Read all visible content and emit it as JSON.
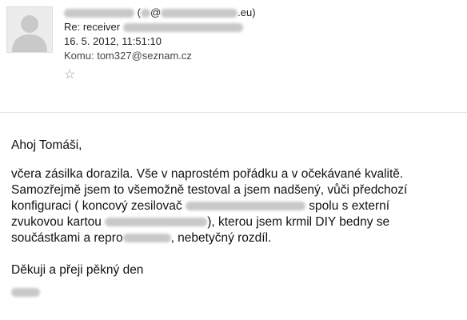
{
  "header": {
    "sender_paren_open": "(",
    "sender_at": "@",
    "sender_domain_tail": ".eu)",
    "subject": "Re: receiver",
    "date": "16. 5. 2012, 11:51:10",
    "to_label": "Komu:",
    "to_email": "tom327@seznam.cz",
    "star": "☆"
  },
  "body": {
    "greeting": "Ahoj Tomáši,",
    "para1_line1": "včera zásilka dorazila. Vše v naprostém pořádku a v očekávané kvalitě.",
    "para1_line2": "Samozřejmě jsem to všemožně testoval a jsem nadšený, vůči předchozí",
    "para1_line3_a": "konfiguraci ( koncový zesilovač",
    "para1_line3_b": "spolu s externí",
    "para1_line4_a": "zvukovou kartou",
    "para1_line4_b": "), kterou jsem krmil DIY bedny se",
    "para1_line5_a": "součástkami a repro",
    "para1_line5_b": ", nebetyčný rozdíl.",
    "closing": "Děkuji a přeji pěkný den"
  },
  "colors": {
    "divider": "#e2e2e2",
    "redaction": "#c8c8c8",
    "star": "#999999"
  },
  "icons": {
    "avatar": "default-user-icon",
    "star": "star-outline-icon"
  }
}
